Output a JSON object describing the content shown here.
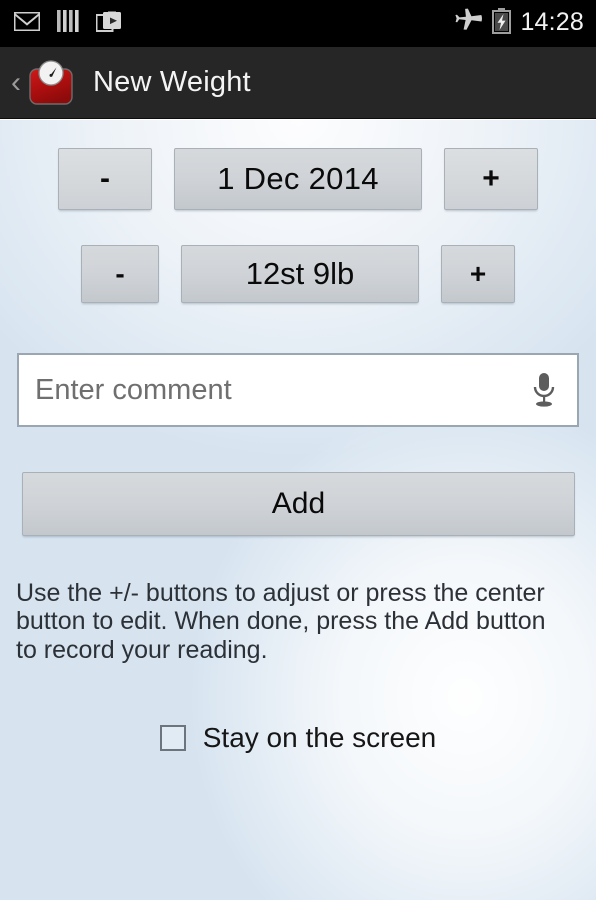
{
  "status_bar": {
    "icons_left": [
      "email-icon",
      "barcode-icon",
      "media-share-icon"
    ],
    "icons_right": [
      "airplane-mode-icon",
      "battery-charging-icon"
    ],
    "clock": "14:28"
  },
  "action_bar": {
    "back_label": "‹",
    "app_icon": "weight-scale-icon",
    "title": "New Weight",
    "background_color": "#262626"
  },
  "form": {
    "date_row": {
      "decrement_label": "-",
      "value": "1 Dec 2014",
      "increment_label": "+"
    },
    "weight_row": {
      "decrement_label": "-",
      "value": "12st 9lb",
      "increment_label": "+"
    },
    "comment": {
      "value": "",
      "placeholder": "Enter comment",
      "mic_icon": "microphone-icon"
    },
    "add_button_label": "Add",
    "instructions": "Use the +/- buttons to adjust or press the center button to edit. When done, press the Add button to record your reading.",
    "stay_on_screen": {
      "label": "Stay on the screen",
      "checked": false
    }
  },
  "colors": {
    "accent_red": "#b51212",
    "button_face": "#d2d6da",
    "status_bar": "#000000"
  }
}
